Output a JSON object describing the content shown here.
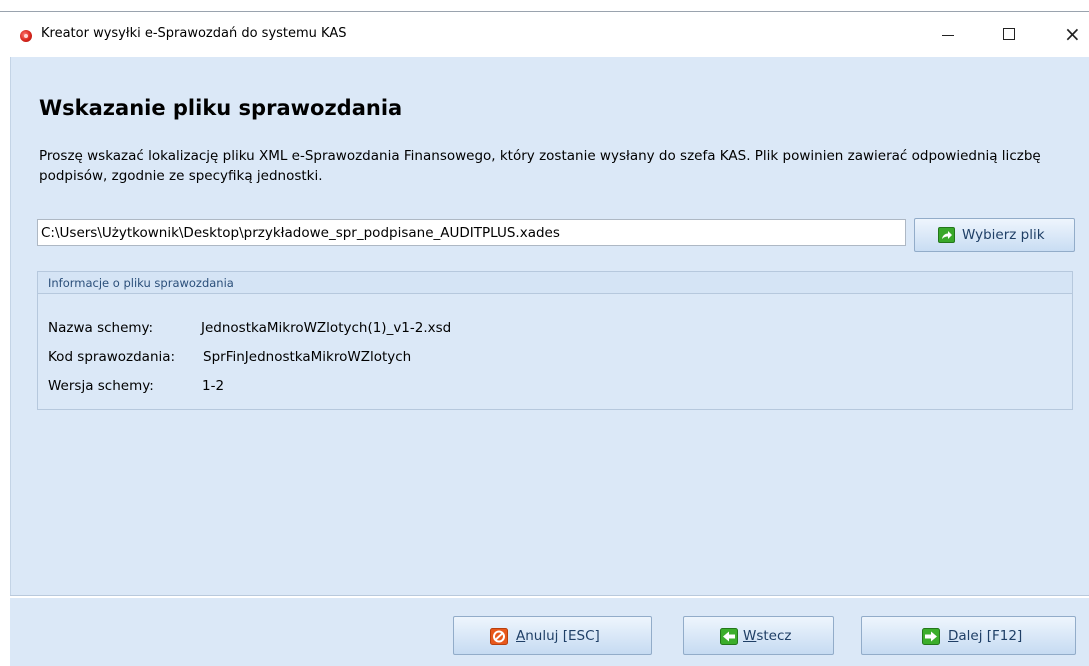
{
  "window": {
    "title": "Kreator wysyłki e-Sprawozdań do systemu KAS",
    "minimize_glyph": "–",
    "maximize_glyph": "☐",
    "close_glyph": "×"
  },
  "page": {
    "title": "Wskazanie pliku sprawozdania",
    "description": "Proszę wskazać lokalizację pliku XML e-Sprawozdania Finansowego, który zostanie wysłany do szefa KAS. Plik powinien zawierać odpowiednią liczbę podpisów, zgodnie ze specyfiką jednostki."
  },
  "file": {
    "path": "C:\\Users\\Użytkownik\\Desktop\\przykładowe_spr_podpisane_AUDITPLUS.xades",
    "browse_label": "Wybierz plik"
  },
  "info": {
    "header": "Informacje o pliku sprawozdania",
    "rows": [
      {
        "label": "Nazwa schemy:",
        "value": "JednostkaMikroWZlotych(1)_v1-2.xsd"
      },
      {
        "label": "Kod sprawozdania:",
        "value": "SprFinJednostkaMikroWZlotych"
      },
      {
        "label": "Wersja schemy:",
        "value": "1-2"
      }
    ]
  },
  "footer": {
    "cancel": {
      "mnemonic": "A",
      "rest": "nuluj [ESC]"
    },
    "back": {
      "mnemonic": "W",
      "rest": "stecz"
    },
    "next": {
      "mnemonic": "D",
      "rest": "alej [F12]"
    }
  },
  "colors": {
    "panel_background": "#dbe8f7",
    "button_text": "#1f3f66",
    "cancel_icon": "#e8581c",
    "nav_icon": "#3cae2b"
  },
  "icons": {
    "app": "red-orb-icon",
    "browse": "green-share-arrow-icon",
    "cancel": "cancel-circle-icon",
    "back": "arrow-left-icon",
    "next": "arrow-right-icon"
  }
}
